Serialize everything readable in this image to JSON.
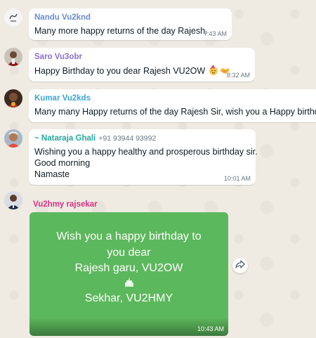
{
  "messages": [
    {
      "sender": "Nandu Vu2knd",
      "sender_color": "#6a8bd8",
      "text": "Many more happy returns of the day Rajesh.",
      "time": "7:43 AM"
    },
    {
      "sender": "Saro Vu3obr",
      "sender_color": "#8c6fd1",
      "text": "Happy Birthday to you dear Rajesh VU2OW",
      "emojis": [
        "party-face-icon",
        "handshake-icon"
      ],
      "time": "8:32 AM"
    },
    {
      "sender": "Kumar Vu2kds",
      "sender_color": "#3aa7d6",
      "text": "Many many Happy returns of the day Rajesh Sir, wish you a Happy birthday"
    },
    {
      "sender": "~ Nataraja Ghali",
      "sender_color": "#26a69a",
      "phone": "+91 93944 93992",
      "lines": [
        "Wishing you a happy healthy and prosperous birthday  sir.",
        "Good morning",
        "Namaste"
      ],
      "time": "10:01 AM"
    },
    {
      "sender": "Vu2hmy rajsekar",
      "sender_color": "#d63384",
      "card": {
        "lines": [
          "Wish you a happy birthday to",
          "you dear",
          "Rajesh garu, VU2OW",
          "Sekhar, VU2HMY"
        ],
        "cake_icon": "cake-icon",
        "background": "#5cb85c"
      },
      "time": "10:43 AM"
    }
  ],
  "forward_icon": "forward-icon"
}
